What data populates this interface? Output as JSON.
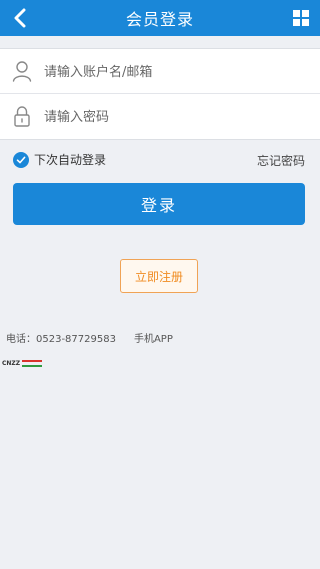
{
  "header": {
    "title": "会员登录",
    "back_icon": "chevron-left-icon",
    "menu_icon": "grid-icon"
  },
  "form": {
    "username_placeholder": "请输入账户名/邮箱",
    "password_placeholder": "请输入密码",
    "username_icon": "user-icon",
    "password_icon": "lock-icon"
  },
  "options": {
    "remember_label": "下次自动登录",
    "remember_checked": true,
    "forgot_label": "忘记密码"
  },
  "actions": {
    "login_label": "登录",
    "register_label": "立即注册"
  },
  "footer": {
    "phone_text": "电话：0523-87729583",
    "app_label": "手机APP",
    "stats_badge": "CNZZ"
  },
  "colors": {
    "primary": "#1a87d8",
    "accent": "#f08c22",
    "background": "#eef0f4"
  }
}
